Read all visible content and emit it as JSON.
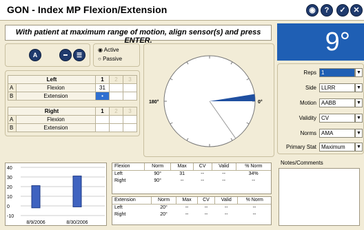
{
  "title": "GON - Index MP Flexion/Extension",
  "title_buttons": [
    {
      "name": "close-round-icon",
      "glyph": "◉"
    },
    {
      "name": "help-icon",
      "glyph": "?"
    },
    {
      "name": "check-icon",
      "glyph": "✓"
    },
    {
      "name": "exit-icon",
      "glyph": "✕"
    }
  ],
  "instruction": "With patient at maximum range of motion, align sensor(s) and press ENTER.",
  "current_value": "9°",
  "sensor": {
    "a_label": "A",
    "mode_active": "Active",
    "mode_passive": "Passive",
    "selected_mode": "Active"
  },
  "left_table": {
    "header": "Left",
    "cols": [
      "1",
      "2",
      "3"
    ],
    "rows": [
      {
        "id": "A",
        "label": "Flexion",
        "values": [
          "31",
          "",
          ""
        ]
      },
      {
        "id": "B",
        "label": "Extension",
        "values": [
          "•",
          "",
          ""
        ]
      }
    ]
  },
  "right_table": {
    "header": "Right",
    "cols": [
      "1",
      "2",
      "3"
    ],
    "rows": [
      {
        "id": "A",
        "label": "Flexion",
        "values": [
          "",
          "",
          ""
        ]
      },
      {
        "id": "B",
        "label": "Extension",
        "values": [
          "",
          "",
          ""
        ]
      }
    ]
  },
  "gauge": {
    "left_label": "180°",
    "right_label": "0°",
    "angle": 9
  },
  "settings": {
    "reps_label": "Reps",
    "reps_value": "1",
    "side_label": "Side",
    "side_value": "LLRR",
    "motion_label": "Motion",
    "motion_value": "AABB",
    "validity_label": "Validity",
    "validity_value": "CV",
    "norms_label": "Norms",
    "norms_value": "AMA",
    "primary_label": "Primary Stat",
    "primary_value": "Maximum"
  },
  "chart_data": {
    "type": "bar",
    "categories": [
      "8/9/2006",
      "8/30/2006"
    ],
    "values": [
      [
        -2,
        21
      ],
      [
        -1,
        31
      ]
    ],
    "ylim": [
      0,
      40
    ],
    "yticks": [
      "40",
      "30",
      "20",
      "10",
      "0",
      "-10"
    ],
    "grid": true
  },
  "results_flexion": {
    "headers": [
      "Flexion",
      "Norm",
      "Max",
      "CV",
      "Valid",
      "% Norm"
    ],
    "rows": [
      [
        "Left",
        "90°",
        "31",
        "--",
        "--",
        "34%"
      ],
      [
        "Right",
        "90°",
        "--",
        "--",
        "--",
        "--"
      ]
    ]
  },
  "results_extension": {
    "headers": [
      "Extension",
      "Norm",
      "Max",
      "CV",
      "Valid",
      "% Norm"
    ],
    "rows": [
      [
        "Left",
        "20°",
        "--",
        "--",
        "--",
        "--"
      ],
      [
        "Right",
        "20°",
        "--",
        "--",
        "--",
        "--"
      ]
    ]
  },
  "notes": {
    "label": "Notes/Comments",
    "value": ""
  }
}
